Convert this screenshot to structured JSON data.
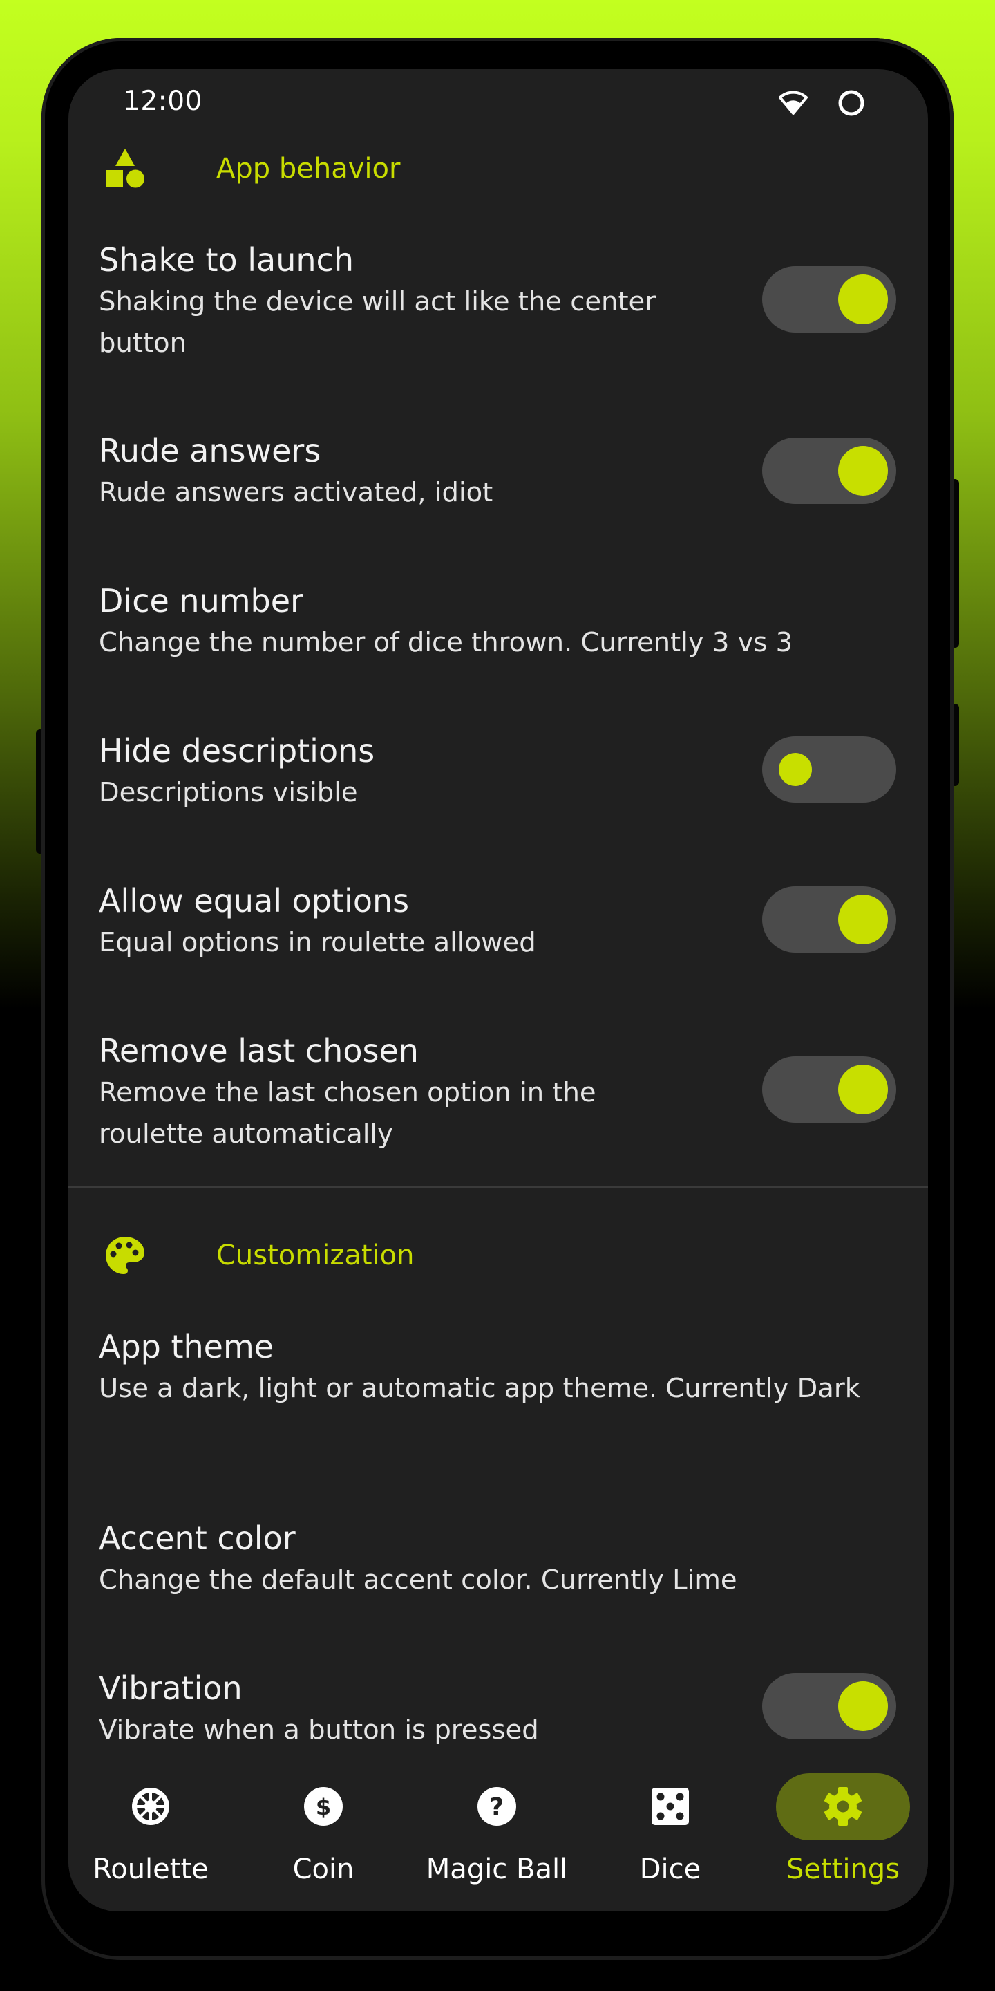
{
  "status_bar": {
    "time": "12:00",
    "icons": [
      "wifi-icon",
      "battery-ring-icon"
    ]
  },
  "accent_color": "#c8df00",
  "sections": [
    {
      "title": "App behavior",
      "icon": "shapes-icon",
      "rows": [
        {
          "title": "Shake to launch",
          "subtitle": "Shaking the device will act like the center button",
          "toggle": true,
          "enabled": true
        },
        {
          "title": "Rude answers",
          "subtitle": "Rude answers activated, idiot",
          "toggle": true,
          "enabled": true
        },
        {
          "title": "Dice number",
          "subtitle": "Change the number of dice thrown. Currently 3 vs 3",
          "toggle": false
        },
        {
          "title": "Hide descriptions",
          "subtitle": "Descriptions visible",
          "toggle": true,
          "enabled": false
        },
        {
          "title": "Allow equal options",
          "subtitle": "Equal options in roulette allowed",
          "toggle": true,
          "enabled": true
        },
        {
          "title": "Remove last chosen",
          "subtitle": "Remove the last chosen option in the roulette automatically",
          "toggle": true,
          "enabled": true
        }
      ]
    },
    {
      "title": "Customization",
      "icon": "palette-icon",
      "rows": [
        {
          "title": "App theme",
          "subtitle": "Use a dark, light or automatic app theme. Currently Dark",
          "toggle": false
        },
        {
          "title": "Accent color",
          "subtitle": "Change the default accent color. Currently Lime",
          "toggle": false
        },
        {
          "title": "Vibration",
          "subtitle": "Vibrate when a button is pressed",
          "toggle": true,
          "enabled": true
        }
      ]
    }
  ],
  "bottom_nav": {
    "items": [
      {
        "label": "Roulette",
        "icon": "roulette-wheel-icon",
        "active": false
      },
      {
        "label": "Coin",
        "icon": "coin-icon",
        "active": false
      },
      {
        "label": "Magic Ball",
        "icon": "question-circle-icon",
        "active": false
      },
      {
        "label": "Dice",
        "icon": "dice-icon",
        "active": false
      },
      {
        "label": "Settings",
        "icon": "gear-icon",
        "active": true
      }
    ]
  }
}
